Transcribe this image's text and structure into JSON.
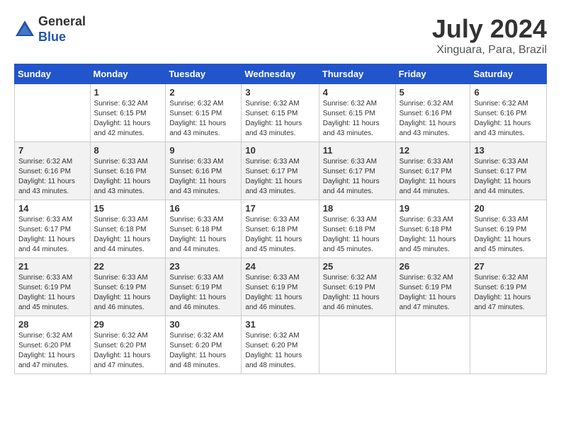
{
  "header": {
    "logo_general": "General",
    "logo_blue": "Blue",
    "title": "July 2024",
    "subtitle": "Xinguara, Para, Brazil"
  },
  "days_of_week": [
    "Sunday",
    "Monday",
    "Tuesday",
    "Wednesday",
    "Thursday",
    "Friday",
    "Saturday"
  ],
  "weeks": [
    [
      {
        "day": "",
        "info": ""
      },
      {
        "day": "1",
        "info": "Sunrise: 6:32 AM\nSunset: 6:15 PM\nDaylight: 11 hours\nand 42 minutes."
      },
      {
        "day": "2",
        "info": "Sunrise: 6:32 AM\nSunset: 6:15 PM\nDaylight: 11 hours\nand 43 minutes."
      },
      {
        "day": "3",
        "info": "Sunrise: 6:32 AM\nSunset: 6:15 PM\nDaylight: 11 hours\nand 43 minutes."
      },
      {
        "day": "4",
        "info": "Sunrise: 6:32 AM\nSunset: 6:15 PM\nDaylight: 11 hours\nand 43 minutes."
      },
      {
        "day": "5",
        "info": "Sunrise: 6:32 AM\nSunset: 6:16 PM\nDaylight: 11 hours\nand 43 minutes."
      },
      {
        "day": "6",
        "info": "Sunrise: 6:32 AM\nSunset: 6:16 PM\nDaylight: 11 hours\nand 43 minutes."
      }
    ],
    [
      {
        "day": "7",
        "info": ""
      },
      {
        "day": "8",
        "info": "Sunrise: 6:33 AM\nSunset: 6:16 PM\nDaylight: 11 hours\nand 43 minutes."
      },
      {
        "day": "9",
        "info": "Sunrise: 6:33 AM\nSunset: 6:16 PM\nDaylight: 11 hours\nand 43 minutes."
      },
      {
        "day": "10",
        "info": "Sunrise: 6:33 AM\nSunset: 6:17 PM\nDaylight: 11 hours\nand 43 minutes."
      },
      {
        "day": "11",
        "info": "Sunrise: 6:33 AM\nSunset: 6:17 PM\nDaylight: 11 hours\nand 44 minutes."
      },
      {
        "day": "12",
        "info": "Sunrise: 6:33 AM\nSunset: 6:17 PM\nDaylight: 11 hours\nand 44 minutes."
      },
      {
        "day": "13",
        "info": "Sunrise: 6:33 AM\nSunset: 6:17 PM\nDaylight: 11 hours\nand 44 minutes."
      }
    ],
    [
      {
        "day": "14",
        "info": ""
      },
      {
        "day": "15",
        "info": "Sunrise: 6:33 AM\nSunset: 6:18 PM\nDaylight: 11 hours\nand 44 minutes."
      },
      {
        "day": "16",
        "info": "Sunrise: 6:33 AM\nSunset: 6:18 PM\nDaylight: 11 hours\nand 44 minutes."
      },
      {
        "day": "17",
        "info": "Sunrise: 6:33 AM\nSunset: 6:18 PM\nDaylight: 11 hours\nand 45 minutes."
      },
      {
        "day": "18",
        "info": "Sunrise: 6:33 AM\nSunset: 6:18 PM\nDaylight: 11 hours\nand 45 minutes."
      },
      {
        "day": "19",
        "info": "Sunrise: 6:33 AM\nSunset: 6:18 PM\nDaylight: 11 hours\nand 45 minutes."
      },
      {
        "day": "20",
        "info": "Sunrise: 6:33 AM\nSunset: 6:19 PM\nDaylight: 11 hours\nand 45 minutes."
      }
    ],
    [
      {
        "day": "21",
        "info": ""
      },
      {
        "day": "22",
        "info": "Sunrise: 6:33 AM\nSunset: 6:19 PM\nDaylight: 11 hours\nand 46 minutes."
      },
      {
        "day": "23",
        "info": "Sunrise: 6:33 AM\nSunset: 6:19 PM\nDaylight: 11 hours\nand 46 minutes."
      },
      {
        "day": "24",
        "info": "Sunrise: 6:33 AM\nSunset: 6:19 PM\nDaylight: 11 hours\nand 46 minutes."
      },
      {
        "day": "25",
        "info": "Sunrise: 6:32 AM\nSunset: 6:19 PM\nDaylight: 11 hours\nand 46 minutes."
      },
      {
        "day": "26",
        "info": "Sunrise: 6:32 AM\nSunset: 6:19 PM\nDaylight: 11 hours\nand 47 minutes."
      },
      {
        "day": "27",
        "info": "Sunrise: 6:32 AM\nSunset: 6:19 PM\nDaylight: 11 hours\nand 47 minutes."
      }
    ],
    [
      {
        "day": "28",
        "info": "Sunrise: 6:32 AM\nSunset: 6:20 PM\nDaylight: 11 hours\nand 47 minutes."
      },
      {
        "day": "29",
        "info": "Sunrise: 6:32 AM\nSunset: 6:20 PM\nDaylight: 11 hours\nand 47 minutes."
      },
      {
        "day": "30",
        "info": "Sunrise: 6:32 AM\nSunset: 6:20 PM\nDaylight: 11 hours\nand 48 minutes."
      },
      {
        "day": "31",
        "info": "Sunrise: 6:32 AM\nSunset: 6:20 PM\nDaylight: 11 hours\nand 48 minutes."
      },
      {
        "day": "",
        "info": ""
      },
      {
        "day": "",
        "info": ""
      },
      {
        "day": "",
        "info": ""
      }
    ]
  ],
  "week7_day7": "Sunrise: 6:32 AM\nSunset: 6:16 PM\nDaylight: 11 hours\nand 43 minutes.",
  "week3_day14": "Sunrise: 6:33 AM\nSunset: 6:17 PM\nDaylight: 11 hours\nand 44 minutes.",
  "week4_day21": "Sunrise: 6:33 AM\nSunset: 6:19 PM\nDaylight: 11 hours\nand 45 minutes."
}
